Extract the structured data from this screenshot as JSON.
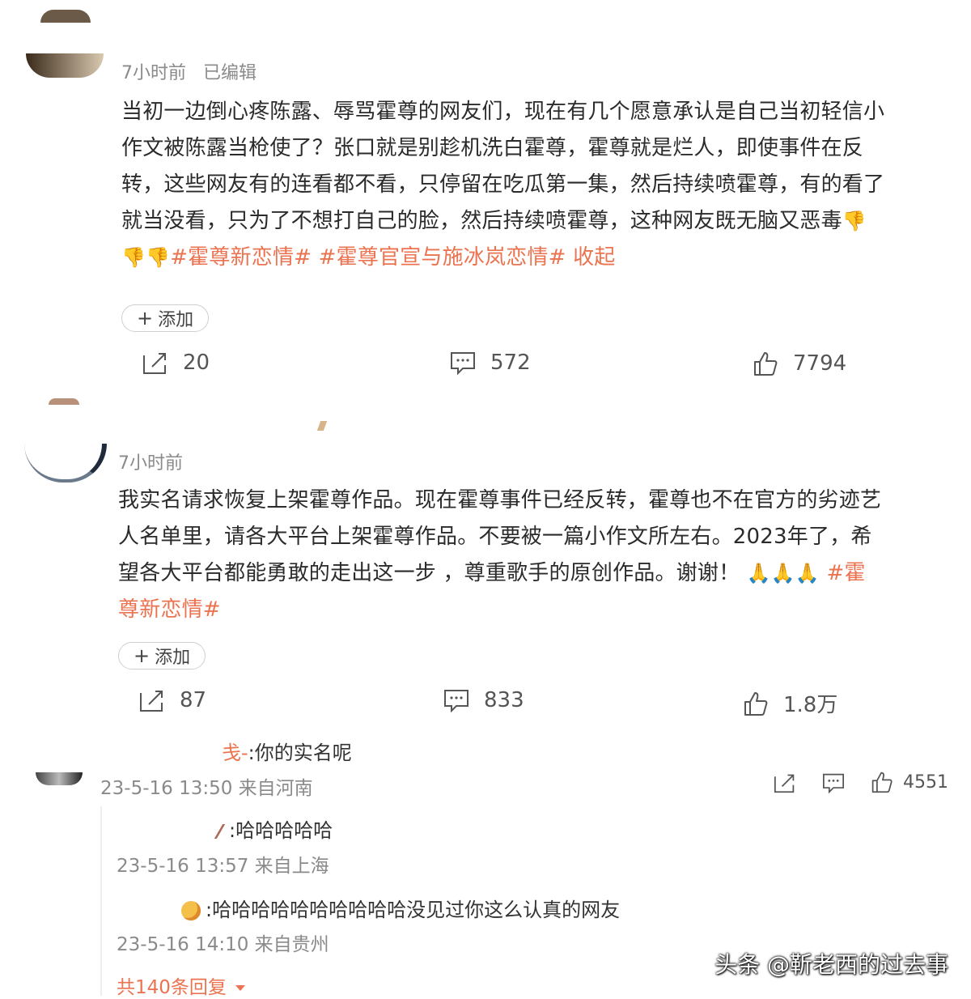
{
  "comment1": {
    "time": "7小时前",
    "edited": "已编辑",
    "lines": [
      "当初一边倒心疼陈露、辱骂霍尊的网友们，现在有几个愿意承认是自己当初轻信小",
      "作文被陈露当枪使了？张口就是别趁机洗白霍尊，霍尊就是烂人，即使事件在反",
      "转，这些网友有的连看都不看，只停留在吃瓜第一集，然后持续喷霍尊，有的看了",
      "就当没看，只为了不想打自己的脸，然后持续喷霍尊，这种网友既无脑又恶毒"
    ],
    "tags": "#霍尊新恋情# #霍尊官宣与施冰岚恋情#",
    "collapse": "收起",
    "add_label": "添加",
    "reposts": "20",
    "comments": "572",
    "likes": "7794"
  },
  "comment2": {
    "time": "7小时前",
    "lines": [
      "我实名请求恢复上架霍尊作品。现在霍尊事件已经反转，霍尊也不在官方的劣迹艺",
      "人名单里，请各大平台上架霍尊作品。不要被一篇小作文所左右。2023年了，希",
      "望各大平台都能勇敢的走出这一步 ，尊重歌手的原创作品。谢谢！"
    ],
    "tag_part1": "#霍",
    "tag_part2": "尊新恋情#",
    "add_label": "添加",
    "reposts": "87",
    "comments": "833",
    "likes": "1.8万"
  },
  "reply1": {
    "name": "戋-",
    "text": ":你的实名呢",
    "meta": "23-5-16 13:50 来自河南",
    "likes": "4551"
  },
  "reply2": {
    "text": ":哈哈哈哈哈",
    "meta": "23-5-16 13:57 来自上海"
  },
  "reply3": {
    "text": ":哈哈哈哈哈哈哈哈哈哈没见过你这么认真的网友",
    "meta": "23-5-16 14:10 来自贵州"
  },
  "more_replies": "共140条回复",
  "watermark": "头条 @靳老西的过去事"
}
